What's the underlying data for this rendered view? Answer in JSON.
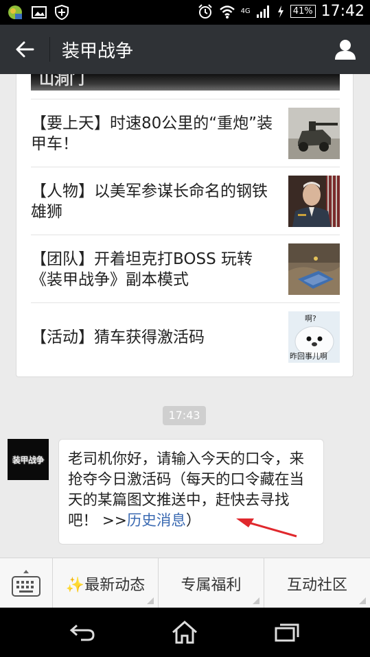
{
  "status_bar": {
    "network": "4G",
    "battery": "41%",
    "time": "17:42"
  },
  "title_bar": {
    "title": "装甲战争"
  },
  "articles": {
    "cover_partial_text": "山洞门",
    "items": [
      {
        "title": "【要上天】时速80公里的“重炮”装甲车！",
        "thumb": "armored-car-image"
      },
      {
        "title": "【人物】以美军参谋长命名的钢铁雄狮",
        "thumb": "general-portrait-image"
      },
      {
        "title": "【团队】开着坦克打BOSS 玩转《装甲战争》副本模式",
        "thumb": "tank-game-image"
      },
      {
        "title": "【活动】猜车获得激活码",
        "thumb": "seal-meme-image",
        "thumb_text_top": "啊?",
        "thumb_text_bottom": "昨回事儿啊"
      }
    ]
  },
  "chat": {
    "timestamp": "17:43",
    "avatar_text": "装甲战争",
    "message": {
      "text": "老司机你好，请输入今天的口令，来抢夺今日激活码（每天的口令藏在当天的某篇图文推送中，赶快去寻找吧！ >>",
      "link": "历史消息",
      "tail": "）"
    }
  },
  "menu": {
    "items": [
      {
        "label": "✨最新动态"
      },
      {
        "label": "专属福利"
      },
      {
        "label": "互动社区"
      }
    ]
  },
  "colors": {
    "title_bar": "#2f3236",
    "link": "#3b6ab2",
    "annotation_arrow": "#e0282d"
  }
}
